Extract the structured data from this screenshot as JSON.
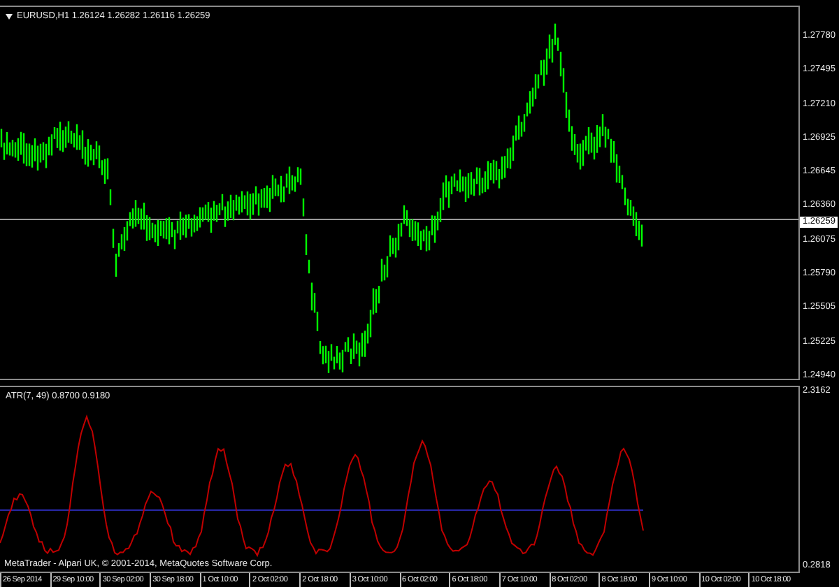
{
  "symbol_bar": {
    "text": "EURUSD,H1  1.26124 1.26282 1.26116 1.26259"
  },
  "price_axis": {
    "labels": [
      "1.27780",
      "1.27495",
      "1.27210",
      "1.26925",
      "1.26645",
      "1.26360",
      "1.26075",
      "1.25790",
      "1.25505",
      "1.25225",
      "1.24940"
    ],
    "current_price": "1.26259"
  },
  "indicator": {
    "label": "ATR(7, 49) 0.8700 0.9180",
    "axis_labels": [
      "2.3162",
      "0.2818"
    ]
  },
  "copyright": "MetaTrader - Alpari UK, © 2001-2014, MetaQuotes Software Corp.",
  "time_axis": [
    "26 Sep 2014",
    "29 Sep 10:00",
    "30 Sep 02:00",
    "30 Sep 18:00",
    "1 Oct 10:00",
    "2 Oct 02:00",
    "2 Oct 18:00",
    "3 Oct 10:00",
    "6 Oct 02:00",
    "6 Oct 18:00",
    "7 Oct 10:00",
    "8 Oct 02:00",
    "8 Oct 18:00",
    "9 Oct 10:00",
    "10 Oct 02:00",
    "10 Oct 18:00"
  ]
}
